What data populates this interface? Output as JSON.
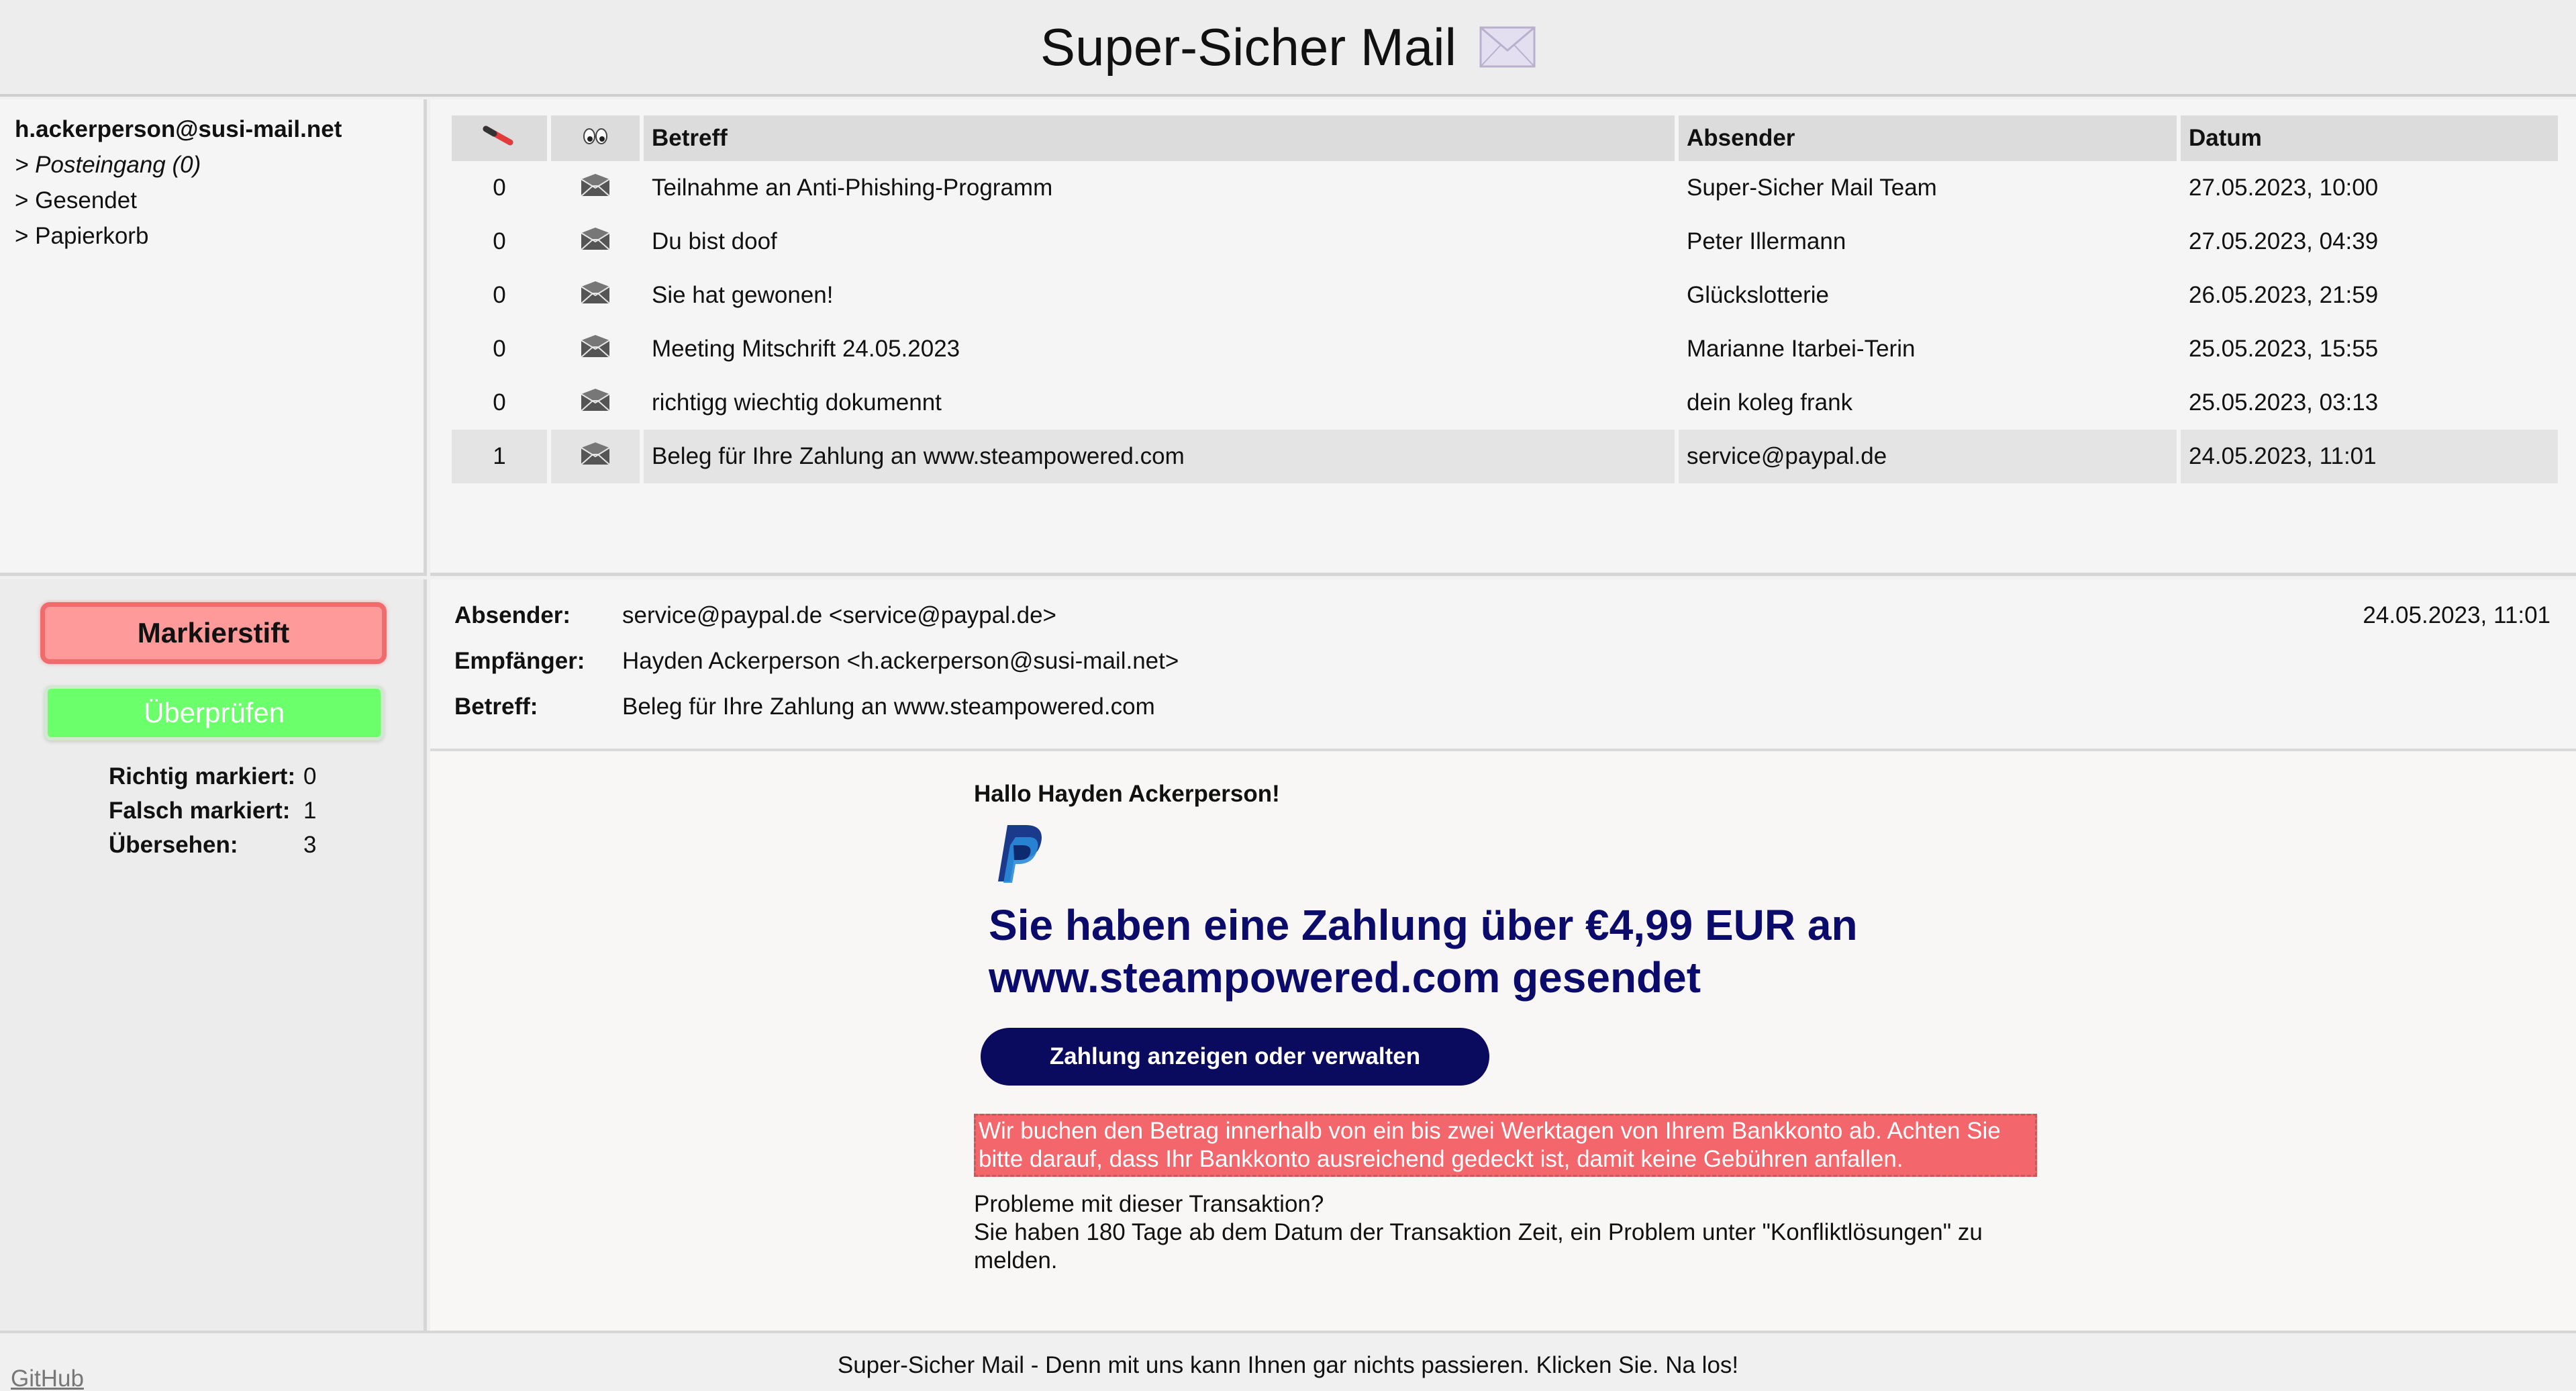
{
  "app": {
    "title": "Super-Sicher Mail"
  },
  "sidebar": {
    "account": "h.ackerperson@susi-mail.net",
    "folders": [
      {
        "label": "> Posteingang (0)"
      },
      {
        "label": "> Gesendet"
      },
      {
        "label": "> Papierkorb"
      }
    ]
  },
  "mail_list": {
    "headers": {
      "subject": "Betreff",
      "sender": "Absender",
      "date": "Datum"
    },
    "rows": [
      {
        "mark": "0",
        "subject": "Teilnahme an Anti-Phishing-Programm",
        "sender": "Super-Sicher Mail Team",
        "date": "27.05.2023, 10:00"
      },
      {
        "mark": "0",
        "subject": "Du bist doof",
        "sender": "Peter Illermann",
        "date": "27.05.2023, 04:39"
      },
      {
        "mark": "0",
        "subject": "Sie hat gewonen!",
        "sender": "Glückslotterie",
        "date": "26.05.2023, 21:59"
      },
      {
        "mark": "0",
        "subject": "Meeting Mitschrift 24.05.2023",
        "sender": "Marianne Itarbei-Terin",
        "date": "25.05.2023, 15:55"
      },
      {
        "mark": "0",
        "subject": "richtigg wiechtig dokumennt",
        "sender": "dein koleg frank",
        "date": "25.05.2023, 03:13"
      },
      {
        "mark": "1",
        "subject": "Beleg für Ihre Zahlung an www.steampowered.com",
        "sender": "service@paypal.de",
        "date": "24.05.2023, 11:01"
      }
    ]
  },
  "tools": {
    "marker_label": "Markierstift",
    "check_label": "Überprüfen",
    "stats": [
      {
        "label": "Richtig markiert:",
        "value": "0"
      },
      {
        "label": "Falsch markiert:",
        "value": "1"
      },
      {
        "label": "Übersehen:",
        "value": "3"
      }
    ]
  },
  "reader": {
    "labels": {
      "sender": "Absender:",
      "recipient": "Empfänger:",
      "subject": "Betreff:"
    },
    "sender": "service@paypal.de <service@paypal.de>",
    "recipient": "Hayden Ackerperson <h.ackerperson@susi-mail.net>",
    "subject": "Beleg für Ihre Zahlung an www.steampowered.com",
    "date": "24.05.2023, 11:01",
    "body": {
      "greeting": "Hallo Hayden Ackerperson!",
      "headline_line1": "Sie haben eine Zahlung über €4,99 EUR an",
      "headline_line2": "www.steampowered.com gesendet",
      "cta": "Zahlung anzeigen oder verwalten",
      "warning": "Wir buchen den Betrag innerhalb von ein bis zwei Werktagen von Ihrem Bankkonto ab. Achten Sie bitte darauf, dass Ihr Bankkonto ausreichend gedeckt ist, damit keine Gebühren anfallen.",
      "problem_title": "Probleme mit dieser Transaktion?",
      "problem_text": "Sie haben 180 Tage ab dem Datum der Transaktion Zeit, ein Problem unter \"Konfliktlösungen\" zu melden."
    }
  },
  "footer": {
    "github": "GitHub",
    "text": "Super-Sicher Mail - Denn mit uns kann Ihnen gar nichts passieren. Klicken Sie. Na los!"
  },
  "colors": {
    "marker_bg": "#ff9a9a",
    "check_bg": "#6cff6c",
    "headline": "#0b0b6b",
    "cta_bg": "#0a0a5e",
    "warning_bg": "#f3666b"
  },
  "icons": [
    "mail-icon",
    "marker-pen-icon",
    "eyes-icon",
    "envelope-icon",
    "paypal-logo"
  ]
}
